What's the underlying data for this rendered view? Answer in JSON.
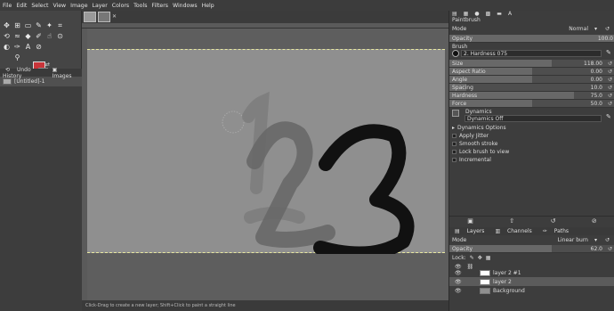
{
  "menu": [
    "File",
    "Edit",
    "Select",
    "View",
    "Image",
    "Layer",
    "Colors",
    "Tools",
    "Filters",
    "Windows",
    "Help"
  ],
  "colors": {
    "foreground": "#c9353a",
    "background": "#ffffff",
    "canvas": "#8f8f8f"
  },
  "toolbox": {
    "icons": [
      "move-icon",
      "align-icon",
      "rect-select-icon",
      "free-select-icon",
      "fuzzy-select-icon",
      "crop-icon",
      "transform-icon",
      "warp-icon",
      "fill-icon",
      "paintbrush-icon",
      "smudge-icon",
      "clone-icon",
      "dodge-icon",
      "path-icon",
      "text-icon",
      "color-picker-icon",
      "zoom-icon"
    ]
  },
  "undo_panel": {
    "tabs": [
      "Undo History",
      "Images"
    ],
    "item": "[Untitled]-1"
  },
  "tool_options": {
    "title": "Paintbrush",
    "mode_label": "Mode",
    "mode_value": "Normal",
    "opacity_label": "Opacity",
    "opacity_value": "100.0",
    "brush_label": "Brush",
    "brush_value": "2. Hardness 075",
    "sliders": [
      {
        "label": "Size",
        "value": "118.00",
        "fraction": 0.62
      },
      {
        "label": "Aspect Ratio",
        "value": "0.00",
        "fraction": 0.5
      },
      {
        "label": "Angle",
        "value": "0.00",
        "fraction": 0.5
      },
      {
        "label": "Spacing",
        "value": "10.0",
        "fraction": 0.1
      },
      {
        "label": "Hardness",
        "value": "75.0",
        "fraction": 0.75
      },
      {
        "label": "Force",
        "value": "50.0",
        "fraction": 0.5
      }
    ],
    "dynamics_label": "Dynamics",
    "dynamics_value": "Dynamics Off",
    "options": [
      "Dynamics Options",
      "Apply Jitter",
      "Smooth stroke",
      "Lock brush to view",
      "Incremental"
    ]
  },
  "layers_panel": {
    "tabs": [
      "Layers",
      "Channels",
      "Paths"
    ],
    "mode_label": "Mode",
    "mode_value": "Linear burn",
    "opacity_label": "Opacity",
    "opacity_value": "62.0",
    "lock_label": "Lock:",
    "layers": [
      "layer 2 #1",
      "layer 2",
      "Background"
    ]
  },
  "statusbar": "Click-Drag to create a new layer; Shift+Click to paint a straight line"
}
